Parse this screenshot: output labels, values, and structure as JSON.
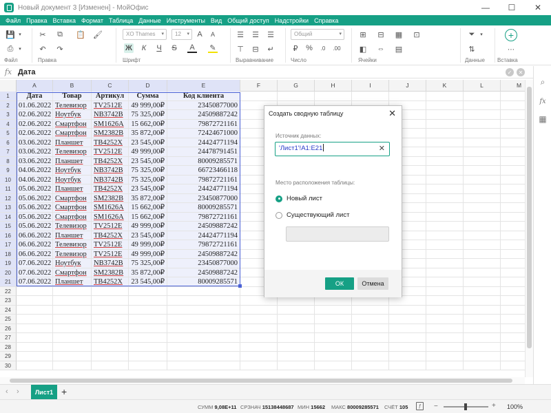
{
  "window": {
    "title": "Новый документ 3 [Изменен] - МойОфис",
    "controls": [
      "—",
      "☐",
      "✕"
    ]
  },
  "menu": [
    "Файл",
    "Правка",
    "Вставка",
    "Формат",
    "Таблица",
    "Данные",
    "Инструменты",
    "Вид",
    "Общий доступ",
    "Надстройки",
    "Справка"
  ],
  "ribbon": {
    "groups": [
      "Файл",
      "Правка",
      "Шрифт",
      "Выравнивание",
      "Число",
      "Ячейки",
      "Данные",
      "Вставка"
    ],
    "font_name": "XO Thames",
    "font_size": "12",
    "number_format": "Общий"
  },
  "formula_bar": {
    "fx": "fx",
    "value": "Дата"
  },
  "columns": [
    "A",
    "B",
    "C",
    "D",
    "E",
    "F",
    "G",
    "H",
    "I",
    "J",
    "K",
    "L",
    "M"
  ],
  "table": {
    "headers": [
      "Дата",
      "Товар",
      "Артикул",
      "Сумма",
      "Код клиента"
    ],
    "rows": [
      [
        "01.06.2022",
        "Телевизор",
        "TV2512E",
        "49 999,00₽",
        "23450877000"
      ],
      [
        "02.06.2022",
        "Ноутбук",
        "NB3742B",
        "75 325,00₽",
        "24509887242"
      ],
      [
        "02.06.2022",
        "Смартфон",
        "SM1626A",
        "15 662,00₽",
        "79872721161"
      ],
      [
        "02.06.2022",
        "Смартфон",
        "SM2382B",
        "35 872,00₽",
        "72424671000"
      ],
      [
        "03.06.2022",
        "Планшет",
        "TB4252X",
        "23 545,00₽",
        "24424771194"
      ],
      [
        "03.06.2022",
        "Телевизор",
        "TV2512E",
        "49 999,00₽",
        "24478791451"
      ],
      [
        "03.06.2022",
        "Планшет",
        "TB4252X",
        "23 545,00₽",
        "80009285571"
      ],
      [
        "04.06.2022",
        "Ноутбук",
        "NB3742B",
        "75 325,00₽",
        "66723466118"
      ],
      [
        "04.06.2022",
        "Ноутбук",
        "NB3742B",
        "75 325,00₽",
        "79872721161"
      ],
      [
        "05.06.2022",
        "Планшет",
        "TB4252X",
        "23 545,00₽",
        "24424771194"
      ],
      [
        "05.06.2022",
        "Смартфон",
        "SM2382B",
        "35 872,00₽",
        "23450877000"
      ],
      [
        "05.06.2022",
        "Смартфон",
        "SM1626A",
        "15 662,00₽",
        "80009285571"
      ],
      [
        "05.06.2022",
        "Смартфон",
        "SM1626A",
        "15 662,00₽",
        "79872721161"
      ],
      [
        "05.06.2022",
        "Телевизор",
        "TV2512E",
        "49 999,00₽",
        "24509887242"
      ],
      [
        "06.06.2022",
        "Планшет",
        "TB4252X",
        "23 545,00₽",
        "24424771194"
      ],
      [
        "06.06.2022",
        "Телевизор",
        "TV2512E",
        "49 999,00₽",
        "79872721161"
      ],
      [
        "06.06.2022",
        "Телевизор",
        "TV2512E",
        "49 999,00₽",
        "24509887242"
      ],
      [
        "07.06.2022",
        "Ноутбук",
        "NB3742B",
        "75 325,00₽",
        "23450877000"
      ],
      [
        "07.06.2022",
        "Смартфон",
        "SM2382B",
        "35 872,00₽",
        "24509887242"
      ],
      [
        "07.06.2022",
        "Планшет",
        "TB4252X",
        "23 545,00₽",
        "80009285571"
      ]
    ],
    "row_count": 30
  },
  "sheets": {
    "active": "Лист1",
    "add": "+"
  },
  "status": {
    "sum_label": "СУММ",
    "sum_value": "9,08E+11",
    "avg_label": "СРЗНАЧ",
    "avg_value": "15138448687",
    "min_label": "МИН",
    "min_value": "15662",
    "max_label": "МАКС",
    "max_value": "80009285571",
    "count_label": "СЧЁТ",
    "count_value": "105",
    "zoom": "100%",
    "zoom_minus": "−",
    "zoom_plus": "+"
  },
  "dialog": {
    "title": "Создать сводную таблицу",
    "source_label": "Источник данных:",
    "source_value": "'Лист1'!A1:E21",
    "location_label": "Место расположения таблицы:",
    "option_new": "Новый лист",
    "option_existing": "Существующий лист",
    "ok": "ОК",
    "cancel": "Отмена"
  },
  "colors": {
    "accent": "#16a085",
    "selection": "#4b62d6"
  }
}
